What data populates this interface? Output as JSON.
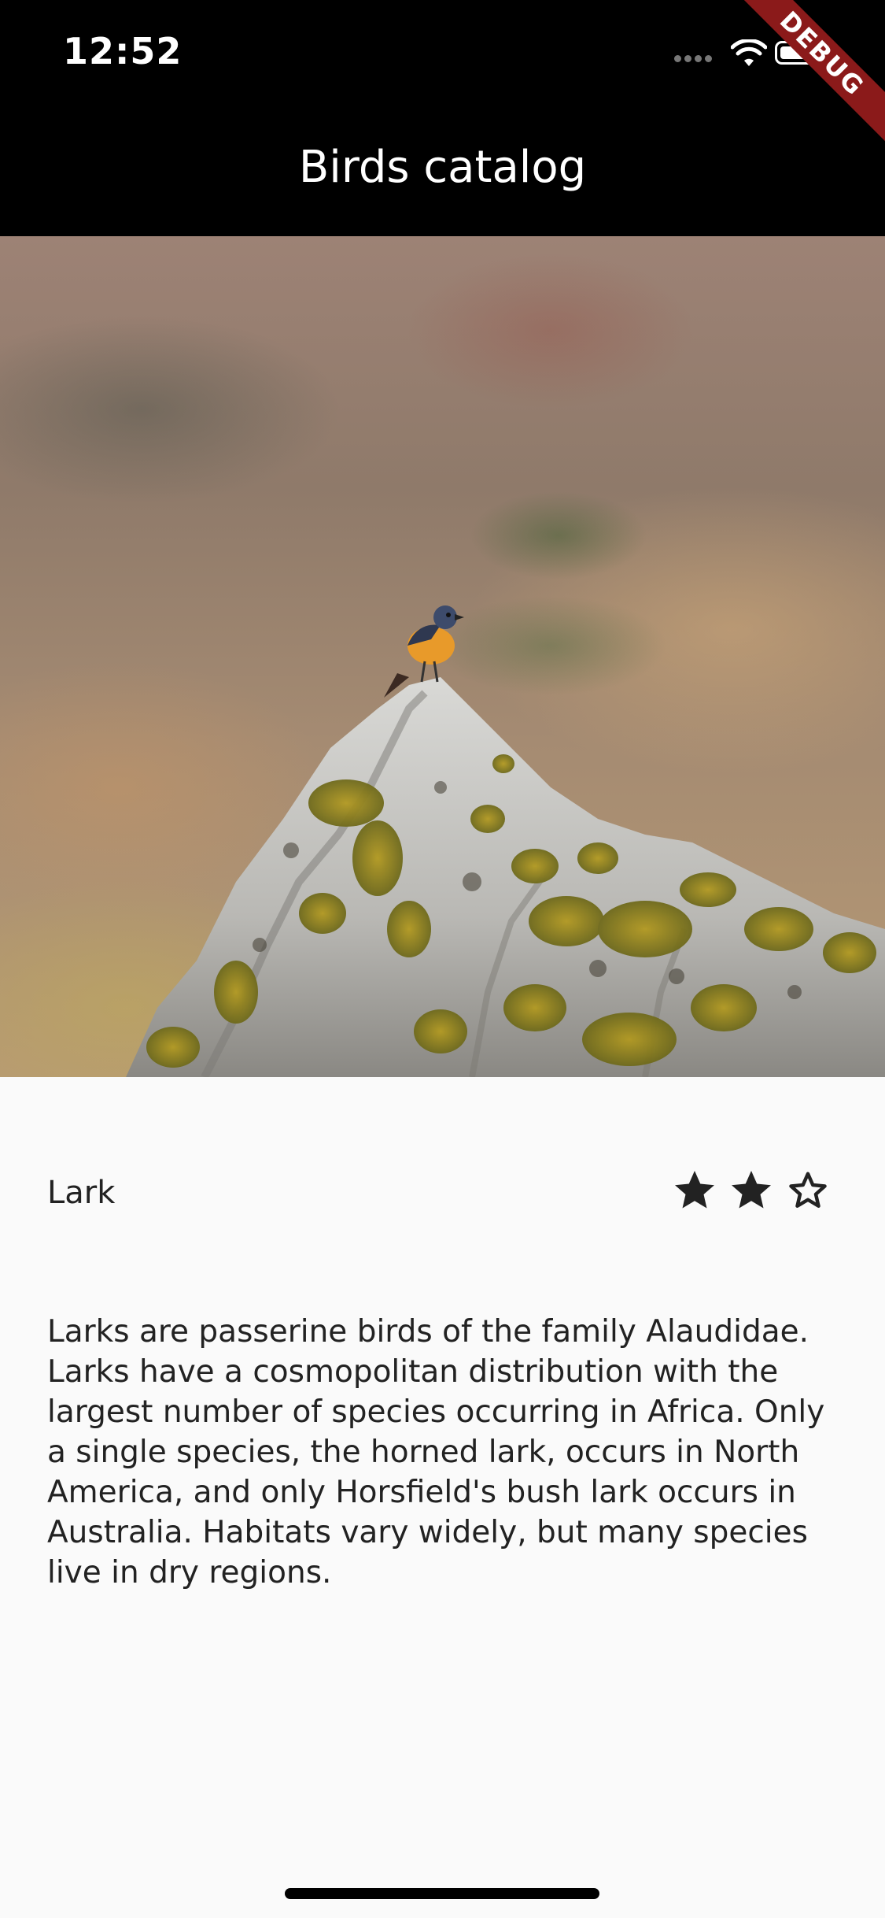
{
  "status_bar": {
    "time": "12:52"
  },
  "app_bar": {
    "title": "Birds catalog",
    "debug_label": "DEBUG"
  },
  "hero_image": {
    "alt": "Bird on rock",
    "subject": "bird perched on lichen-covered rock"
  },
  "bird": {
    "name": "Lark",
    "rating": {
      "filled": 2,
      "max": 3
    },
    "description": "Larks are passerine birds of the family Alaudidae. Larks have a cosmopolitan distribution with the largest number of species occurring in Africa. Only a single species, the horned lark, occurs in North America, and only Horsfield's bush lark occurs in Australia. Habitats vary widely, but many species live in dry regions."
  },
  "icons": {
    "signal": "signal-icon",
    "wifi": "wifi-icon",
    "battery": "battery-icon",
    "star_filled": "star-filled-icon",
    "star_outline": "star-outline-icon"
  },
  "colors": {
    "app_bar": "#000000",
    "background": "#fafafa",
    "text": "#222222",
    "debug_banner": "#8b1a1a"
  }
}
